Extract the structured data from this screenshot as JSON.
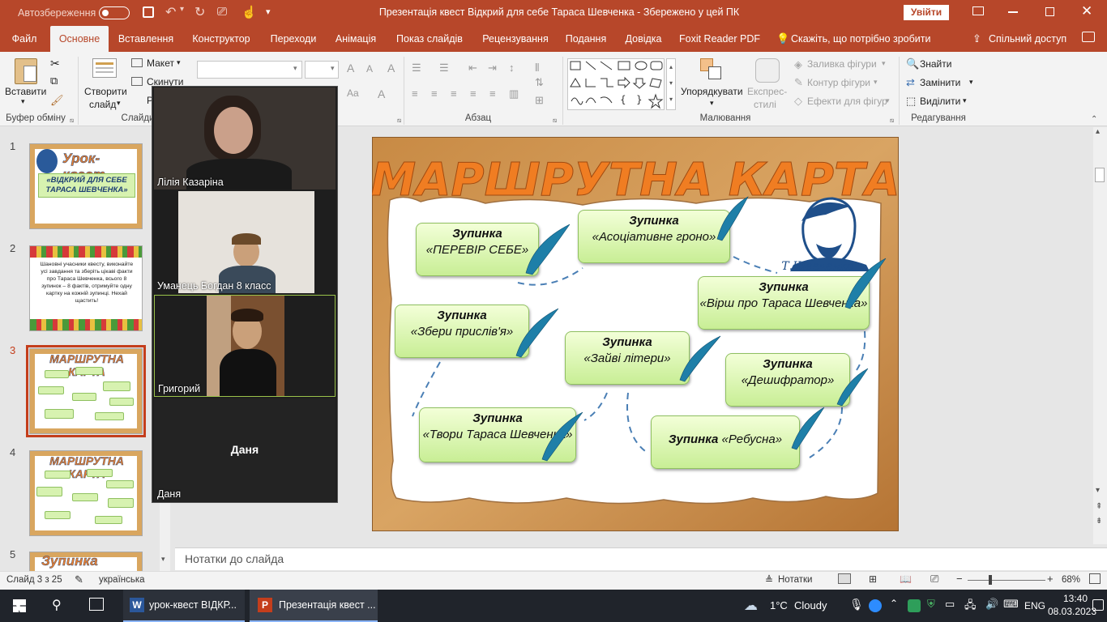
{
  "titlebar": {
    "autosave_label": "Автозбереження",
    "autosave_state": "Вимк.",
    "title": "Презентація квест Відкрий для себе Тараса Шевченка  -  Збережено у цей ПК",
    "signin": "Увійти"
  },
  "tabs": [
    "Файл",
    "Основне",
    "Вставлення",
    "Конструктор",
    "Переходи",
    "Анімація",
    "Показ слайдів",
    "Рецензування",
    "Подання",
    "Довідка",
    "Foxit Reader PDF"
  ],
  "tellme": "Скажіть, що потрібно зробити",
  "share": "Спільний доступ",
  "ribbon": {
    "paste": "Вставити",
    "clipboard_group": "Буфер обміну",
    "new_slide_line1": "Створити",
    "new_slide_line2": "слайд",
    "layout": "Макет",
    "reset": "Скинути",
    "section_short": "Р",
    "slides_group": "Слайди",
    "paragraph_group": "Абзац",
    "drawing_group": "Малювання",
    "arrange": "Упорядкувати",
    "quick_styles_line1": "Експрес-",
    "quick_styles_line2": "стилі",
    "shape_fill": "Заливка фігури",
    "shape_outline": "Контур фігури",
    "shape_effects": "Ефекти для фігур",
    "find": "Знайти",
    "replace": "Замінити",
    "select": "Виділити",
    "editing_group": "Редагування"
  },
  "thumbnails": [
    {
      "num": "1",
      "title": "Урок-квест",
      "subtitle": "«ВІДКРИЙ ДЛЯ СЕБЕ ТАРАСА ШЕВЧЕНКА»"
    },
    {
      "num": "2",
      "text": "Шановні учасники квесту, виконайте усі завдання та зберіть цікаві факти про Тараса Шевченка, всього 8 зупинок – 8 фактів, отримуйте одну картку на кожній зупинці. Нехай щастить!"
    },
    {
      "num": "3",
      "title": "МАРШРУТНА КАРТА"
    },
    {
      "num": "4",
      "title": "МАРШРУТНА КАРТА"
    },
    {
      "num": "5",
      "title": "Зупинка"
    }
  ],
  "slide": {
    "title": "МАРШРУТНА КАРТА",
    "signature": "Т.Шевченко",
    "stops": [
      {
        "label": "Зупинка",
        "name": "«ПЕРЕВІР СЕБЕ»"
      },
      {
        "label": "Зупинка",
        "name": "«Асоціативне гроно»"
      },
      {
        "label": "Зупинка",
        "name": "«Вірш про Тараса Шевченка»"
      },
      {
        "label": "Зупинка",
        "name": "«Збери прислів'я»"
      },
      {
        "label": "Зупинка",
        "name": "«Зайві літери»"
      },
      {
        "label": "Зупинка",
        "name": "«Дешифратор»"
      },
      {
        "label": "Зупинка",
        "name": "«Твори Тараса Шевченка»"
      },
      {
        "label": "Зупинка",
        "name": "«Ребусна»"
      }
    ]
  },
  "video": {
    "participants": [
      {
        "name": "Лілія Казаріна"
      },
      {
        "name": "Уманець Богдан 8 класс"
      },
      {
        "name": "Григорий"
      },
      {
        "name": "Даня",
        "center_label": "Даня"
      }
    ]
  },
  "notes_placeholder": "Нотатки до слайда",
  "status": {
    "slide_info": "Слайд 3 з 25",
    "language": "українська",
    "notes_btn": "Нотатки",
    "zoom": "68%"
  },
  "taskbar": {
    "word_app": "урок-квест ВІДКР...",
    "ppt_app": "Презентація квест ...",
    "weather_temp": "1°C",
    "weather_text": "Cloudy",
    "lang": "ENG",
    "time": "13:40",
    "date": "08.03.2023"
  },
  "colors": {
    "accent": "#b7472a",
    "slide_selected": "#c43e1c",
    "stop_fill": "#d6f3a8",
    "title_orange": "#f07d22"
  }
}
